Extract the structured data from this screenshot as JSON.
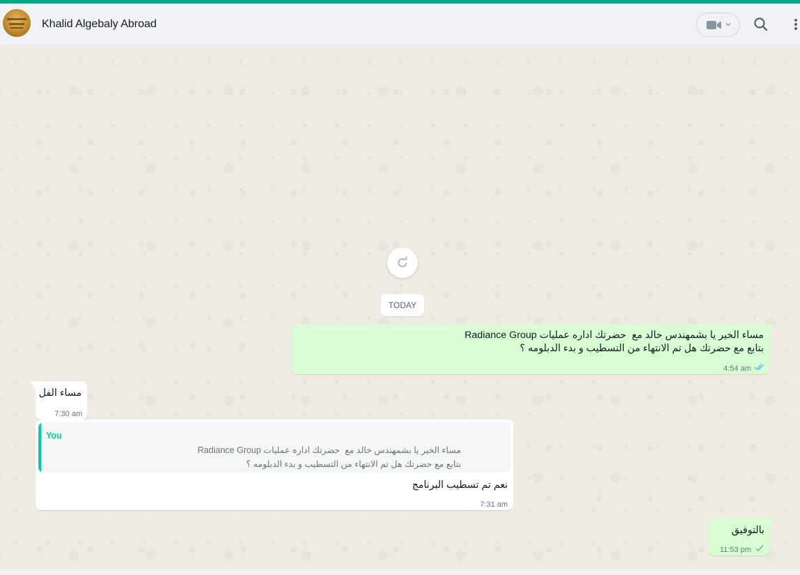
{
  "header": {
    "contact_name": "Khalid Algebaly Abroad",
    "avatar_icon": "contact-avatar",
    "video_call_icon": "video-camera-icon",
    "search_icon": "search-icon",
    "menu_icon": "more-vertical-icon"
  },
  "colors": {
    "accent": "#00a884",
    "outgoing_bubble": "#d9fdd3",
    "incoming_bubble": "#ffffff",
    "chat_background": "#efeae2",
    "read_ticks": "#53bdeb",
    "quote_accent": "#06cf9c"
  },
  "chat": {
    "refresh_icon": "refresh-icon",
    "date_label": "TODAY",
    "messages": [
      {
        "direction": "outgoing",
        "text": "مساء الخير يا بشمهندس خالد مع  حضرتك اداره عمليات Radiance Group\nبتابع مع حضرتك هل تم الانتهاء من التسطيب و بدء الدبلومه ؟",
        "time": "4:54 am",
        "status": "read"
      },
      {
        "direction": "incoming",
        "text": "مساء الفل",
        "time": "7:30 am"
      },
      {
        "direction": "incoming",
        "quote": {
          "author": "You",
          "text": "مساء الخير يا بشمهندس خالد مع  حضرتك اداره عمليات Radiance Group\nبتابع مع حضرتك هل تم الانتهاء من التسطيب و بدء الدبلومه ؟"
        },
        "text": "نعم تم تسطيب البرنامج",
        "time": "7:31 am"
      },
      {
        "direction": "outgoing",
        "text": "بالتوفيق",
        "time": "11:53 pm",
        "status": "sent"
      }
    ]
  }
}
